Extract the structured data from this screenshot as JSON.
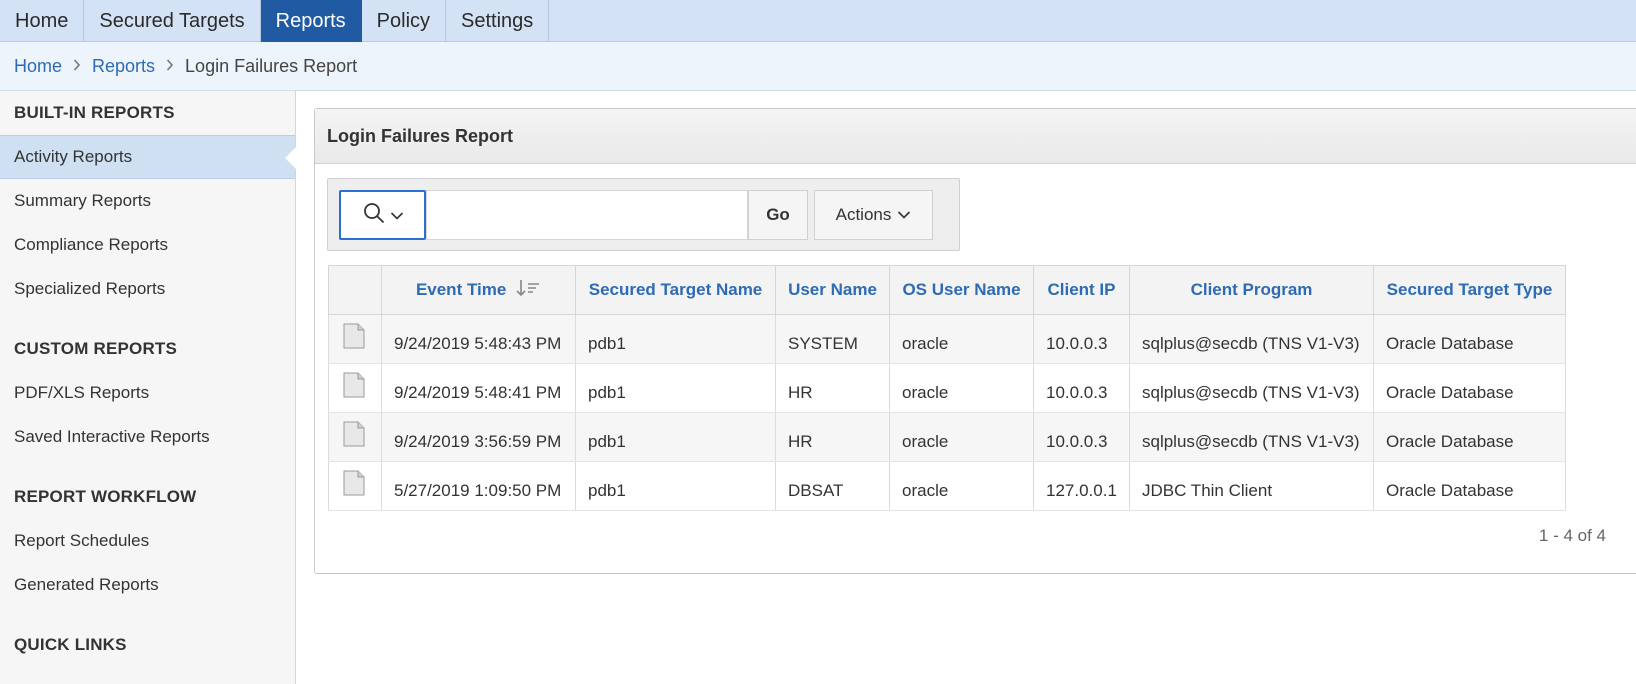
{
  "nav": {
    "tabs": [
      "Home",
      "Secured Targets",
      "Reports",
      "Policy",
      "Settings"
    ],
    "active_index": 2
  },
  "breadcrumb": {
    "home": "Home",
    "reports": "Reports",
    "current": "Login Failures Report"
  },
  "sidebar": {
    "builtin_heading": "BUILT-IN REPORTS",
    "builtin_items": [
      "Activity Reports",
      "Summary Reports",
      "Compliance Reports",
      "Specialized Reports"
    ],
    "custom_heading": "CUSTOM REPORTS",
    "custom_items": [
      "PDF/XLS Reports",
      "Saved Interactive Reports"
    ],
    "workflow_heading": "REPORT WORKFLOW",
    "workflow_items": [
      "Report Schedules",
      "Generated Reports"
    ],
    "quick_heading": "QUICK LINKS"
  },
  "report": {
    "title": "Login Failures Report",
    "search_value": "",
    "go_label": "Go",
    "actions_label": "Actions",
    "columns": [
      "Event Time",
      "Secured Target Name",
      "User Name",
      "OS User Name",
      "Client IP",
      "Client Program",
      "Secured Target Type"
    ],
    "rows": [
      [
        "9/24/2019 5:48:43 PM",
        "pdb1",
        "SYSTEM",
        "oracle",
        "10.0.0.3",
        "sqlplus@secdb (TNS V1-V3)",
        "Oracle Database"
      ],
      [
        "9/24/2019 5:48:41 PM",
        "pdb1",
        "HR",
        "oracle",
        "10.0.0.3",
        "sqlplus@secdb (TNS V1-V3)",
        "Oracle Database"
      ],
      [
        "9/24/2019 3:56:59 PM",
        "pdb1",
        "HR",
        "oracle",
        "10.0.0.3",
        "sqlplus@secdb (TNS V1-V3)",
        "Oracle Database"
      ],
      [
        "5/27/2019 1:09:50 PM",
        "pdb1",
        "DBSAT",
        "oracle",
        "127.0.0.1",
        "JDBC Thin Client",
        "Oracle Database"
      ]
    ],
    "pagination": "1 - 4 of 4"
  },
  "icons": {
    "search": "search-icon",
    "chevron": "chevron-down-icon",
    "sort": "sort-descending-icon",
    "row": "document-icon"
  },
  "colors": {
    "nav_bg": "#d3e2f4",
    "nav_active": "#1f5aa3",
    "link": "#2e6bb3",
    "focus": "#2b6fd3"
  }
}
